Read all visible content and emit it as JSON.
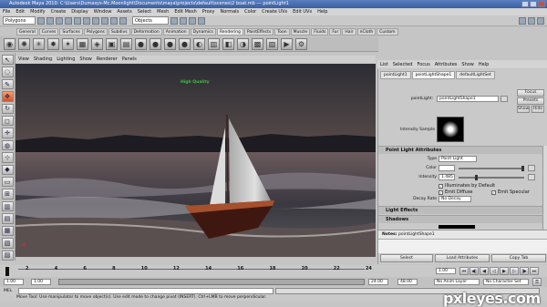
{
  "title": "Autodesk Maya 2010: C:\\Users\\Dumasys-Mc.Moonlight\\Documents\\maya\\projects\\default\\scenes\\2 boat.mb  ---  pointLight1",
  "menu": [
    "File",
    "Edit",
    "Modify",
    "Create",
    "Display",
    "Window",
    "Assets",
    "Select",
    "Mesh",
    "Edit Mesh",
    "Proxy",
    "Normals",
    "Color",
    "Create UVs",
    "Edit UVs",
    "Help"
  ],
  "status": {
    "mode": "Polygons",
    "objects_field": "Objects"
  },
  "shelf_tabs": [
    "General",
    "Curves",
    "Surfaces",
    "Polygons",
    "Subdivs",
    "Deformation",
    "Animation",
    "Dynamics",
    "Rendering",
    "PaintEffects",
    "Toon",
    "Muscle",
    "Fluids",
    "Fur",
    "Hair",
    "nCloth",
    "Custom"
  ],
  "shelf_active": "Rendering",
  "panel_menu": [
    "View",
    "Shading",
    "Lighting",
    "Show",
    "Renderer",
    "Panels"
  ],
  "viewport": {
    "hud_label": "High Quality"
  },
  "attr_menu": [
    "List",
    "Selected",
    "Focus",
    "Attributes",
    "Show",
    "Help"
  ],
  "attr_tabs": [
    "pointLight1",
    "pointLightShape1",
    "defaultLightSet"
  ],
  "attr": {
    "node_label": "pointLight:",
    "node_value": "pointLightShape1",
    "focus": "Focus",
    "presets": "Presets",
    "show": "Show",
    "hide": "Hide",
    "intensity_sample": "Intensity Sample",
    "section_point": "Point Light Attributes",
    "type_label": "Type",
    "type_value": "Point Light",
    "color_label": "Color",
    "intensity_label": "Intensity",
    "intensity_value": "1.485",
    "illum_default": "Illuminates by Default",
    "emit_diffuse": "Emit Diffuse",
    "emit_specular": "Emit Specular",
    "decay_label": "Decay Rate",
    "decay_value": "No Decay",
    "section_effects": "Light Effects",
    "section_shadows": "Shadows",
    "notes_label": "Notes:",
    "notes_value": "pointLightShape1",
    "btn_select": "Select",
    "btn_load": "Load Attributes",
    "btn_copy": "Copy Tab"
  },
  "timeline": {
    "ticks": [
      "1",
      "2",
      "4",
      "6",
      "8",
      "10",
      "12",
      "14",
      "16",
      "18",
      "20",
      "22",
      "24"
    ],
    "current": "1.00"
  },
  "range": {
    "start": "1.00",
    "start2": "1.00",
    "end": "24.00",
    "end2": "48.00",
    "anim_layer": "No Anim Layer",
    "char_set": "No Character Set"
  },
  "cmd_label": "MEL",
  "help_text": "Move Tool: Use manipulator to move object(s). Use edit mode to change pivot (INSERT). Ctrl+LMB to move perpendicular.",
  "watermark": "pxleyes.com"
}
